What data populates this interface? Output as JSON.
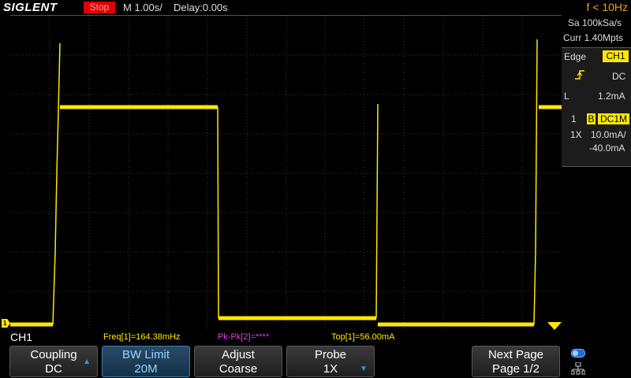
{
  "header": {
    "brand": "SIGLENT",
    "run_status": "Stop",
    "timebase": "M 1.00s/",
    "delay": "Delay:0.00s",
    "frequency": "f < 10Hz"
  },
  "acquisition": {
    "sample_rate": "Sa 100kSa/s",
    "memory_depth": "Curr 1.40Mpts"
  },
  "trigger": {
    "type_label": "Edge",
    "source": "CH1",
    "coupling": "DC",
    "slope_icon": "rising-edge-icon",
    "level_label": "L",
    "level": "1.2mA"
  },
  "channel": {
    "number": "1",
    "bw_badge": "B",
    "coupling_badge": "DC1M",
    "probe": "1X",
    "scale": "10.0mA/",
    "offset": "-40.0mA"
  },
  "measurements": {
    "channel_label": "CH1",
    "freq": "Freq[1]=164.38mHz",
    "pkpk": "Pk-Pk[2]=****",
    "top": "Top[1]=56.00mA"
  },
  "softkeys": [
    {
      "line1": "Coupling",
      "line2": "DC"
    },
    {
      "line1": "BW Limit",
      "line2": "20M"
    },
    {
      "line1": "Adjust",
      "line2": "Coarse"
    },
    {
      "line1": "Probe",
      "line2": "1X"
    },
    {
      "line1": "Next Page",
      "line2": "Page 1/2"
    }
  ],
  "channel_marker_label": "1",
  "colors": {
    "trace": "#ffe800",
    "accent": "#1aa3e6",
    "stop": "#e10000",
    "freq": "#f0a020",
    "meas_freq": "#ffe800",
    "meas_pkpk": "#e040e0",
    "meas_top": "#ffe800"
  }
}
